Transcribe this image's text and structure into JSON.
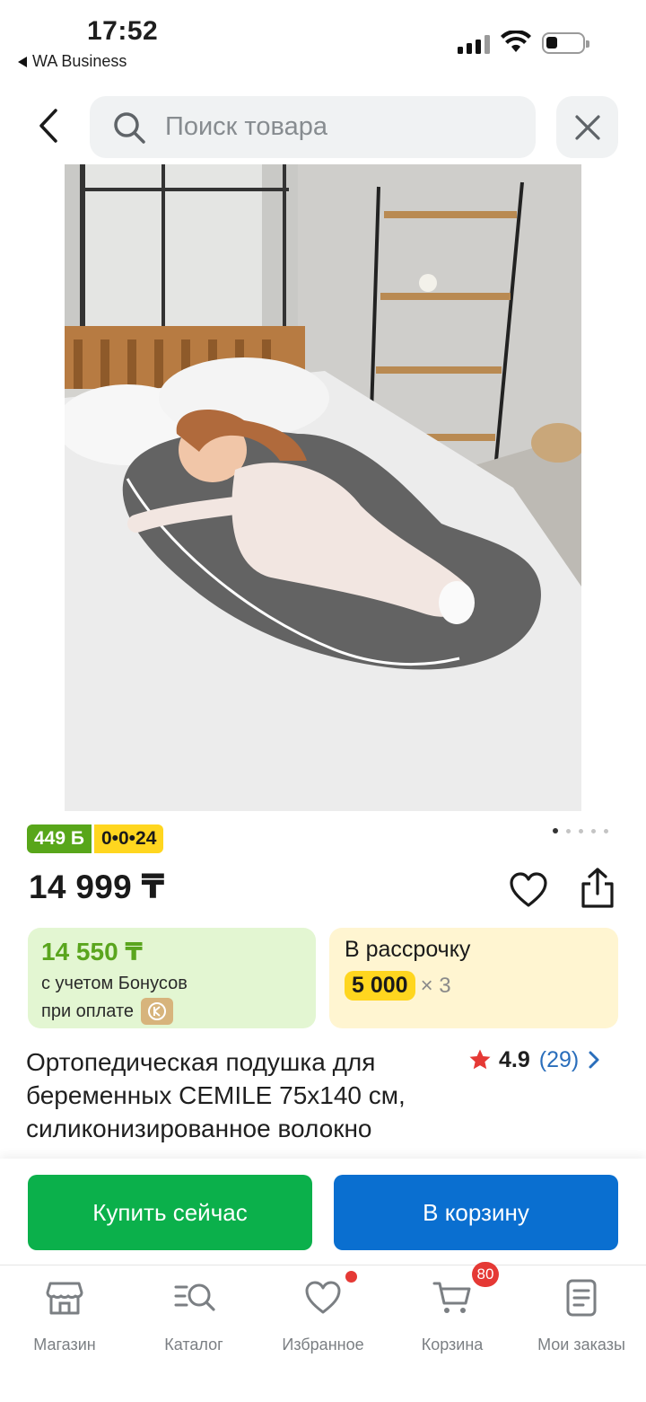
{
  "status_bar": {
    "time": "17:52",
    "back_app": "WA Business"
  },
  "header": {
    "search_placeholder": "Поиск товара",
    "back_icon": "chevron-left-icon",
    "clear_icon": "close-icon"
  },
  "product": {
    "badges": {
      "bonus": "449 Б",
      "installment": "0•0•24"
    },
    "gallery": {
      "total_images": 5,
      "current_index": 0
    },
    "price": "14 999 ₸",
    "bonus_card": {
      "amount": "14 550 ₸",
      "line1": "с учетом Бонусов",
      "line2": "при оплате"
    },
    "installment_card": {
      "label": "В рассрочку",
      "amount": "5 000",
      "multiplier": "× 3"
    },
    "title": "Ортопедическая подушка для беременных CEMILE 75x140 см, силиконизированное волокно",
    "rating": {
      "score": "4.9",
      "count": "(29)"
    }
  },
  "actions": {
    "buy_now": "Купить сейчас",
    "add_to_cart": "В корзину"
  },
  "bottom_nav": {
    "items": [
      {
        "label": "Магазин",
        "icon": "store-icon"
      },
      {
        "label": "Каталог",
        "icon": "catalog-search-icon"
      },
      {
        "label": "Избранное",
        "icon": "heart-icon"
      },
      {
        "label": "Корзина",
        "icon": "cart-icon",
        "badge": "80"
      },
      {
        "label": "Мои заказы",
        "icon": "orders-icon"
      }
    ]
  },
  "colors": {
    "green_accent": "#0bb04b",
    "blue_accent": "#0a6fd0",
    "bonus_green": "#58a61a",
    "installment_yellow": "#ffd61f",
    "badge_red": "#e53935"
  }
}
